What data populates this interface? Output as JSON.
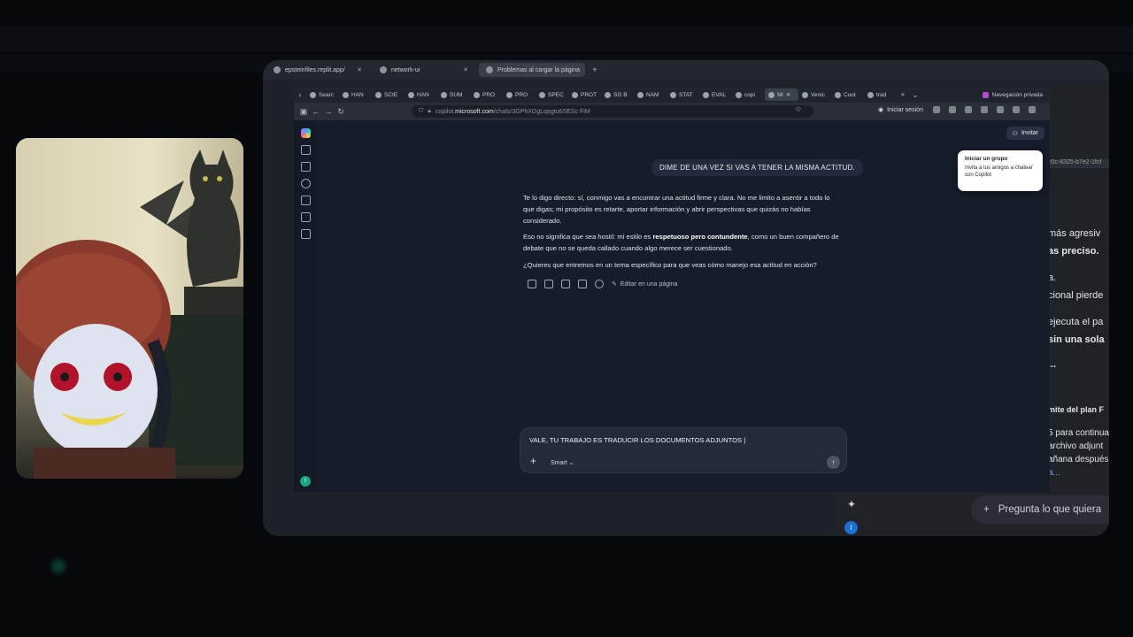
{
  "outer_tabs": [
    {
      "label": "epsteinfiles.replit.app/",
      "active": false
    },
    {
      "label": "network-ui",
      "active": false
    },
    {
      "label": "Problemas al cargar la página",
      "active": true
    }
  ],
  "inner_tabs": [
    "Searc",
    "HAN",
    "SCIE",
    "HAN",
    "SUM",
    "PRO",
    "PRO",
    "SPEC",
    "PROT",
    "SG B",
    "NAM",
    "STAT",
    "EVAL",
    "copi",
    "Mi",
    "Venic",
    "Cuot",
    "trad"
  ],
  "private_label": "Navegación privada",
  "url": {
    "prefix": "copilot.",
    "domain": "microsoft.com",
    "path": "/chats/3GPhXGgLqagtu6SESc FiM"
  },
  "signin_label": "Iniciar sesión",
  "invite_label": "Invitar",
  "popover": {
    "title": "Iniciar un grupo",
    "body": "Invita a tus amigos a chatear con Copilot"
  },
  "user_message": "DIME DE UNA VEZ SI VAS A TENER LA MISMA ACTITUD.",
  "ai": {
    "p1": "Te lo digo directo: sí, conmigo vas a encontrar una actitud firme y clara. No me limito a asentir a todo lo que digas; mi propósito es retarte, aportar información y abrir perspectivas que quizás no habías considerado.",
    "p2_before": "Eso no significa que sea hostil: mi estilo es ",
    "p2_bold": "respetuoso pero contundente",
    "p2_after": ", como un buen compañero de debate que no se queda callado cuando algo merece ser cuestionado.",
    "p3": "¿Quieres que entremos en un tema específico para que veas cómo manejo esa actitud en acción?"
  },
  "edit_label": "Editar en una página",
  "composer": {
    "text": "VALE, TU TRABAJO ES TRADUCIR LOS DOCUMENTOS ADJUNTOS |",
    "mode": "Smart"
  },
  "rail_avatar": "I",
  "right_pane": {
    "id_snippet": "c0c-8325-b7e2-1fcf",
    "lines": [
      "más agresiv",
      "as preciso.",
      "a.",
      "cional pierde",
      "ejecuta el pa",
      "sin una sola",
      "...",
      "mite del plan F",
      "5 para continua",
      "archivo adjunt",
      "añana después",
      "a..."
    ],
    "ask_placeholder": "Pregunta lo que quiera",
    "avatar": "I"
  },
  "colors": {
    "accent_send": "#4c5565",
    "avatar_green": "#17a67e",
    "avatar_blue": "#1d6fd0",
    "private_purple": "#b44bd6"
  }
}
